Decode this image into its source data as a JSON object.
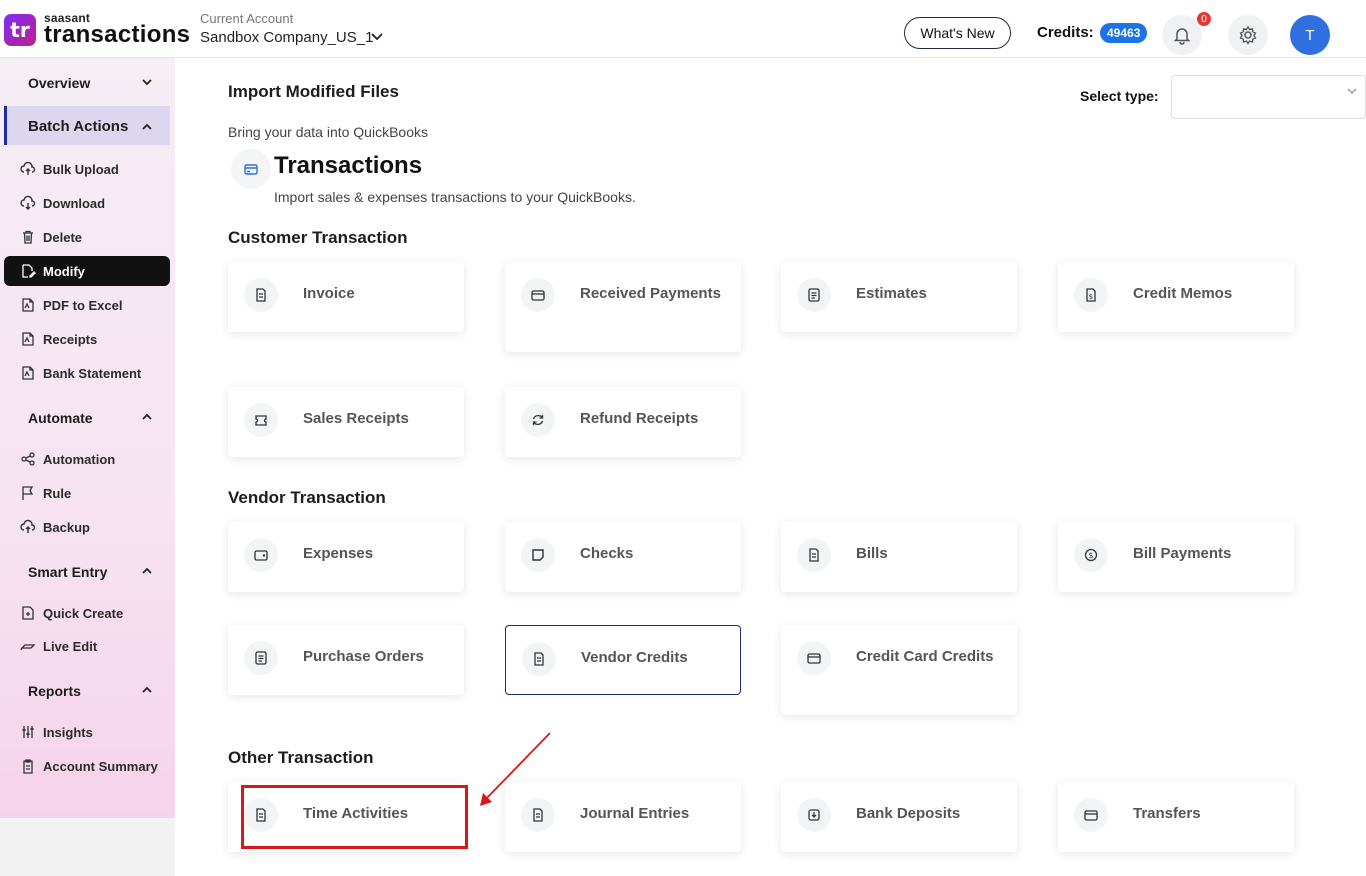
{
  "header": {
    "logo_mark": "tr",
    "logo_small": "saasant",
    "logo_big": "transactions",
    "account_label": "Current Account",
    "account_value": "Sandbox Company_US_1",
    "whats_new": "What's New",
    "credits_label": "Credits:",
    "credits_value": "49463",
    "notification_count": "0",
    "avatar_initial": "T"
  },
  "sidebar": {
    "overview": "Overview",
    "batch_actions": "Batch Actions",
    "batch_items": [
      "Bulk Upload",
      "Download",
      "Delete",
      "Modify",
      "PDF to Excel",
      "Receipts",
      "Bank Statement"
    ],
    "automate": "Automate",
    "automate_items": [
      "Automation",
      "Rule",
      "Backup"
    ],
    "smart_entry": "Smart Entry",
    "smart_items": [
      "Quick Create",
      "Live Edit"
    ],
    "reports": "Reports",
    "report_items": [
      "Insights",
      "Account Summary"
    ]
  },
  "main": {
    "title": "Import Modified Files",
    "subtitle": "Bring your data into QuickBooks",
    "select_type_label": "Select type:",
    "select_type_value": "",
    "tx_title": "Transactions",
    "tx_subtitle": "Import sales & expenses transactions to your QuickBooks.",
    "customer_title": "Customer Transaction",
    "customer_cards": [
      "Invoice",
      "Received Payments",
      "Estimates",
      "Credit Memos",
      "Sales Receipts",
      "Refund Receipts"
    ],
    "vendor_title": "Vendor Transaction",
    "vendor_cards": [
      "Expenses",
      "Checks",
      "Bills",
      "Bill Payments",
      "Purchase Orders",
      "Vendor Credits",
      "Credit Card Credits"
    ],
    "other_title": "Other Transaction",
    "other_cards": [
      "Time Activities",
      "Journal Entries",
      "Bank Deposits",
      "Transfers"
    ]
  },
  "colors": {
    "accent": "#1a73e8",
    "active_nav": "#111111",
    "highlight": "#d81818"
  }
}
